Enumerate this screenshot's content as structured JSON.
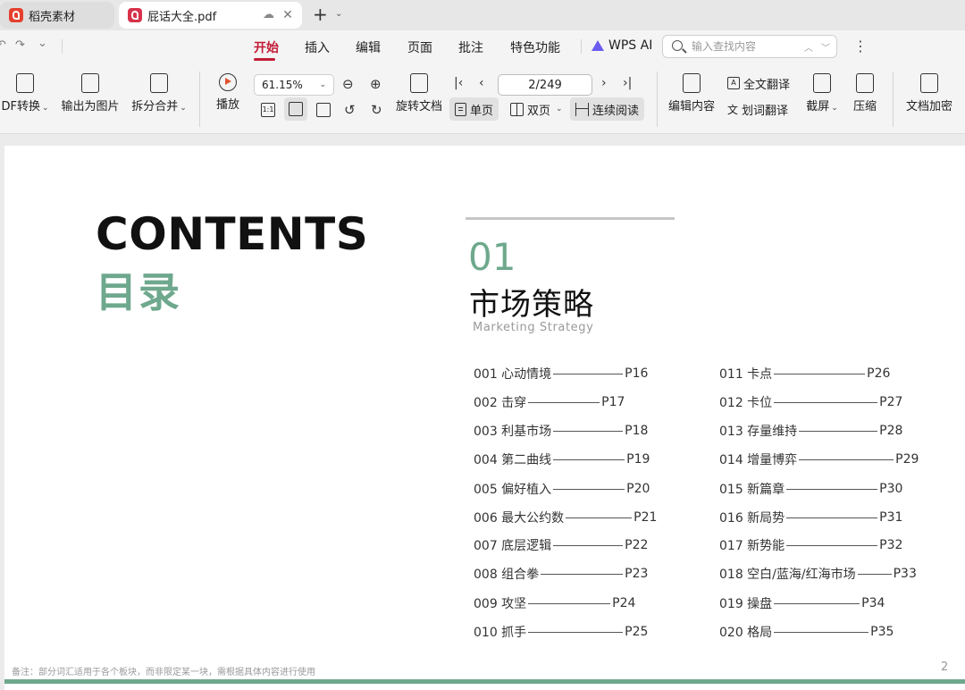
{
  "tabs": [
    {
      "title": "稻壳素材",
      "logo": "docer-logo-icon",
      "active": false
    },
    {
      "title": "屁话大全.pdf",
      "logo": "pdf-logo-icon",
      "active": true
    }
  ],
  "menu": {
    "items": [
      "开始",
      "插入",
      "编辑",
      "页面",
      "批注",
      "特色功能"
    ],
    "active": "开始",
    "ai_label": "WPS AI",
    "search_placeholder": "输入查找内容"
  },
  "ribbon": {
    "pdf_convert": "DF转换",
    "export_image": "输出为图片",
    "split_merge": "拆分合并",
    "play": "播放",
    "zoom": "61.15%",
    "rotate": "旋转文档",
    "page_indicator": "2/249",
    "single_page": "单页",
    "double_page": "双页",
    "continuous": "连续阅读",
    "edit_content": "编辑内容",
    "full_translate": "全文翻译",
    "word_translate": "划词翻译",
    "screenshot": "截屏",
    "compress": "压缩",
    "encrypt": "文档加密"
  },
  "document": {
    "contents_title": "CONTENTS",
    "contents_sub": "目录",
    "section_number": "01",
    "section_title": "市场策略",
    "section_en": "Marketing  Strategy",
    "toc_left": [
      {
        "label": "001 心动情境",
        "page": "P16"
      },
      {
        "label": "002 击穿",
        "page": "P17"
      },
      {
        "label": "003 利基市场",
        "page": "P18"
      },
      {
        "label": "004 第二曲线",
        "page": "P19"
      },
      {
        "label": "005 偏好植入",
        "page": "P20"
      },
      {
        "label": "006 最大公约数",
        "page": "P21"
      },
      {
        "label": "007 底层逻辑",
        "page": "P22"
      },
      {
        "label": "008 组合拳",
        "page": "P23"
      },
      {
        "label": "009 攻坚",
        "page": "P24"
      },
      {
        "label": "010 抓手",
        "page": "P25"
      }
    ],
    "toc_right": [
      {
        "label": "011 卡点",
        "page": "P26"
      },
      {
        "label": "012 卡位",
        "page": "P27"
      },
      {
        "label": "013 存量维持",
        "page": "P28"
      },
      {
        "label": "014 增量博弈",
        "page": "P29"
      },
      {
        "label": "015 新篇章",
        "page": "P30"
      },
      {
        "label": "016 新局势",
        "page": "P31"
      },
      {
        "label": "017 新势能",
        "page": "P32"
      },
      {
        "label": "018 空白/蓝海/红海市场",
        "page": "P33"
      },
      {
        "label": "019 操盘",
        "page": "P34"
      },
      {
        "label": "020 格局",
        "page": "P35"
      }
    ],
    "footnote": "备注：部分词汇适用于各个板块，而非限定某一块，需根据具体内容进行使用",
    "page_number": "2"
  },
  "colors": {
    "accent_green": "#6ea88d",
    "active_menu": "#c21a35"
  }
}
